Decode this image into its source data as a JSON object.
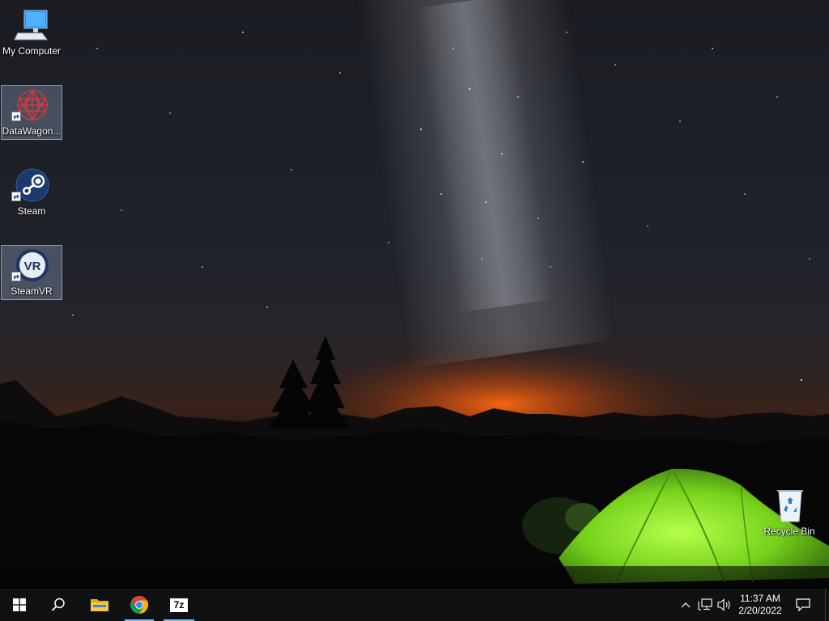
{
  "desktop": {
    "icons": [
      {
        "label": "My Computer",
        "icon": "computer-icon",
        "shortcut": false,
        "selected": false
      },
      {
        "label": "DataWagon...",
        "icon": "datawagon-icon",
        "shortcut": true,
        "selected": true
      },
      {
        "label": "Steam",
        "icon": "steam-icon",
        "shortcut": true,
        "selected": false
      },
      {
        "label": "SteamVR",
        "icon": "steamvr-icon",
        "shortcut": true,
        "selected": true
      },
      {
        "label": "Recycle Bin",
        "icon": "recycle-bin-icon",
        "shortcut": false,
        "selected": false
      }
    ],
    "wallpaper": "night sky with milky way, mountains and lit green tent"
  },
  "taskbar": {
    "pinned": [
      {
        "name": "start",
        "icon": "windows-logo-icon",
        "running": false
      },
      {
        "name": "search",
        "icon": "search-icon",
        "running": false
      },
      {
        "name": "file-explorer",
        "icon": "folder-icon",
        "running": false
      },
      {
        "name": "chrome",
        "icon": "chrome-icon",
        "running": true
      },
      {
        "name": "7zip",
        "icon": "7zip-icon",
        "running": true
      }
    ],
    "sevenzip_text": "7z",
    "tray": [
      "chevron-up-icon",
      "network-icon",
      "volume-icon"
    ],
    "clock": {
      "time": "11:37 AM",
      "date": "2/20/2022"
    },
    "notification": "action-center-icon",
    "accent": "#76b9ed",
    "background": "#101113"
  }
}
